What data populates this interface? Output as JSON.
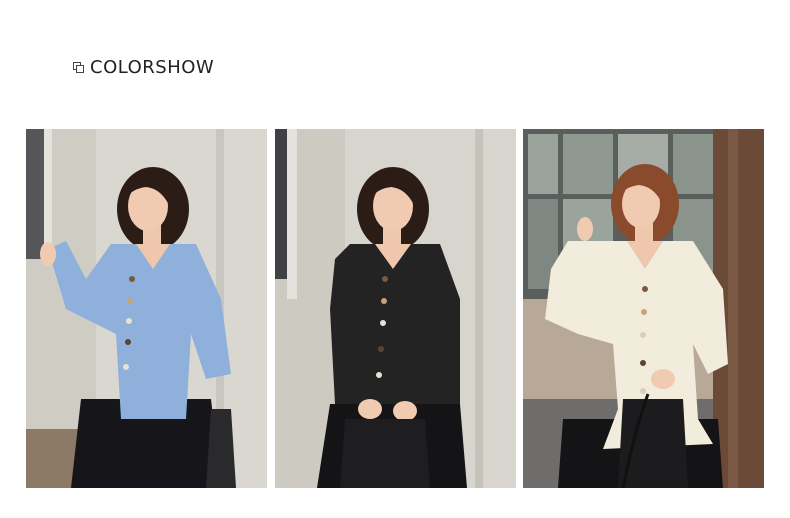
{
  "header": {
    "title": "COLORSHOW",
    "icon": "overlapping-squares-icon"
  },
  "photos": [
    {
      "color": "#8eb0da"
    },
    {
      "color": "#232323"
    },
    {
      "color": "#f2ecdc"
    }
  ]
}
